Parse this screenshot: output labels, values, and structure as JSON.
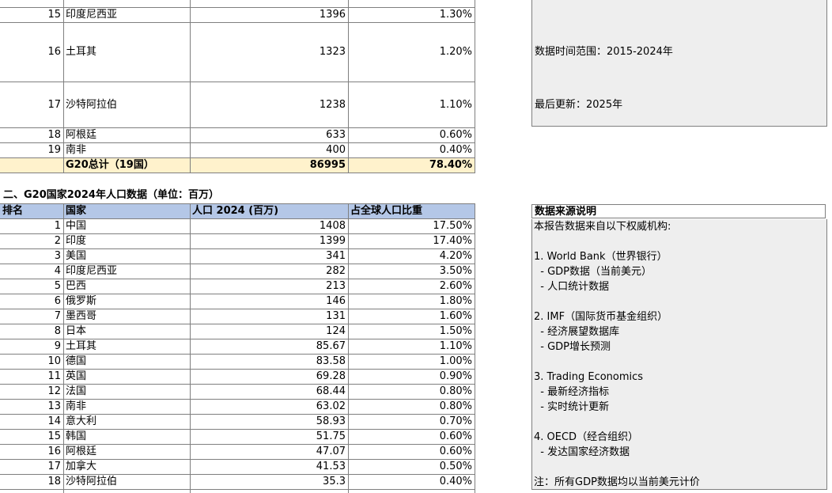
{
  "top_table": {
    "rows": [
      {
        "rank": "15",
        "country": "印度尼西亚",
        "value": "1396",
        "pct": "1.30%"
      },
      {
        "rank": "16",
        "country": "土耳其",
        "value": "1323",
        "pct": "1.20%"
      },
      {
        "rank": "17",
        "country": "沙特阿拉伯",
        "value": "1238",
        "pct": "1.10%"
      },
      {
        "rank": "18",
        "country": "阿根廷",
        "value": "633",
        "pct": "0.60%"
      },
      {
        "rank": "19",
        "country": "南非",
        "value": "400",
        "pct": "0.40%"
      }
    ],
    "total": {
      "label": "G20总计（19国）",
      "value": "86995",
      "pct": "78.40%"
    }
  },
  "notes": {
    "time_range": "数据时间范围：2015-2024年",
    "last_update": "最后更新：2025年"
  },
  "section2": {
    "title": "二、G20国家2024年人口数据（单位：百万）",
    "headers": {
      "rank": "排名",
      "country": "国家",
      "population": "人口 2024 (百万)",
      "share": "占全球人口比重"
    },
    "rows": [
      {
        "rank": "1",
        "country": "中国",
        "population": "1408",
        "share": "17.50%"
      },
      {
        "rank": "2",
        "country": "印度",
        "population": "1399",
        "share": "17.40%"
      },
      {
        "rank": "3",
        "country": "美国",
        "population": "341",
        "share": "4.20%"
      },
      {
        "rank": "4",
        "country": "印度尼西亚",
        "population": "282",
        "share": "3.50%"
      },
      {
        "rank": "5",
        "country": "巴西",
        "population": "213",
        "share": "2.60%"
      },
      {
        "rank": "6",
        "country": "俄罗斯",
        "population": "146",
        "share": "1.80%"
      },
      {
        "rank": "7",
        "country": "墨西哥",
        "population": "131",
        "share": "1.60%"
      },
      {
        "rank": "8",
        "country": "日本",
        "population": "124",
        "share": "1.50%"
      },
      {
        "rank": "9",
        "country": "土耳其",
        "population": "85.67",
        "share": "1.10%"
      },
      {
        "rank": "10",
        "country": "德国",
        "population": "83.58",
        "share": "1.00%"
      },
      {
        "rank": "11",
        "country": "英国",
        "population": "69.28",
        "share": "0.90%"
      },
      {
        "rank": "12",
        "country": "法国",
        "population": "68.44",
        "share": "0.80%"
      },
      {
        "rank": "13",
        "country": "南非",
        "population": "63.02",
        "share": "0.80%"
      },
      {
        "rank": "14",
        "country": "意大利",
        "population": "58.93",
        "share": "0.70%"
      },
      {
        "rank": "15",
        "country": "韩国",
        "population": "51.75",
        "share": "0.60%"
      },
      {
        "rank": "16",
        "country": "阿根廷",
        "population": "47.07",
        "share": "0.60%"
      },
      {
        "rank": "17",
        "country": "加拿大",
        "population": "41.53",
        "share": "0.50%"
      },
      {
        "rank": "18",
        "country": "沙特阿拉伯",
        "population": "35.3",
        "share": "0.40%"
      }
    ]
  },
  "sources": {
    "title": "数据来源说明",
    "lines": [
      "本报告数据来自以下权威机构:",
      "",
      "1. World Bank（世界银行）",
      "  - GDP数据（当前美元）",
      "  - 人口统计数据",
      "",
      "2. IMF（国际货币基金组织）",
      "  - 经济展望数据库",
      "  - GDP增长预测",
      "",
      "3. Trading Economics",
      "  - 最新经济指标",
      "  - 实时统计更新",
      "",
      "4. OECD（经合组织）",
      "  - 发达国家经济数据",
      "",
      "注：所有GDP数据均以当前美元计价"
    ]
  },
  "colors": {
    "total_row": "#fff2cc",
    "header_row": "#b4c7e7",
    "note_bg": "#eeeeee",
    "grid": "#7f7f7f"
  }
}
